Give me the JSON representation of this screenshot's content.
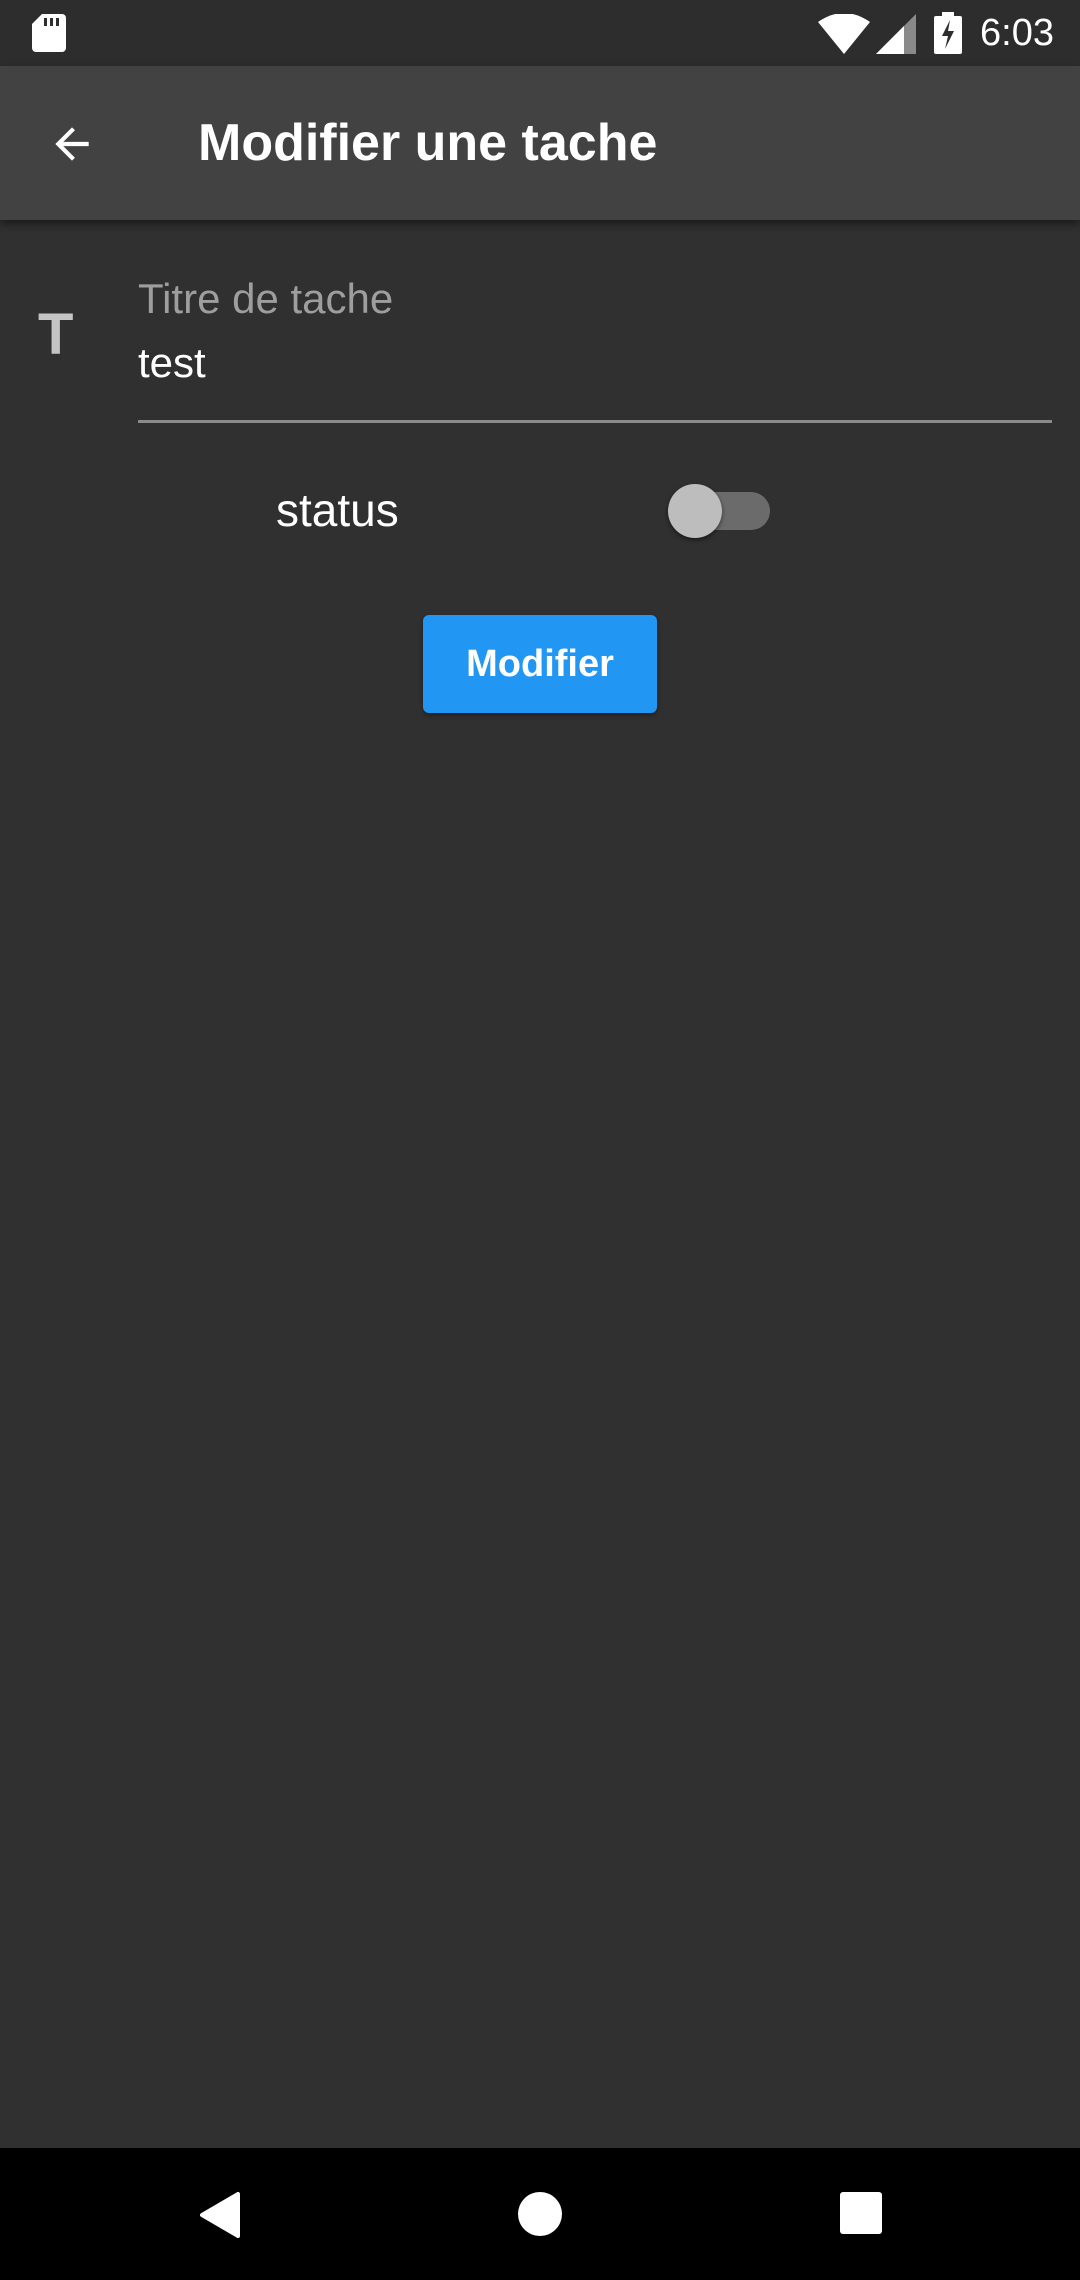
{
  "status_bar": {
    "time": "6:03",
    "icons": [
      "sd-card-icon",
      "wifi-icon",
      "cell-signal-icon",
      "battery-charging-icon"
    ]
  },
  "app_bar": {
    "back_icon": "arrow-back-icon",
    "title": "Modifier une tache"
  },
  "form": {
    "prefix_icon": "T",
    "title_field": {
      "label": "Titre de tache",
      "value": "test"
    },
    "status": {
      "label": "status",
      "checked": false
    },
    "submit_label": "Modifier"
  },
  "nav_bar": {
    "icons": [
      "nav-back-icon",
      "nav-home-icon",
      "nav-recents-icon"
    ]
  },
  "colors": {
    "background": "#303030",
    "app_bar": "#424242",
    "accent": "#2196f3",
    "status_bar": "#2d2d2d",
    "nav_bar": "#000000"
  }
}
